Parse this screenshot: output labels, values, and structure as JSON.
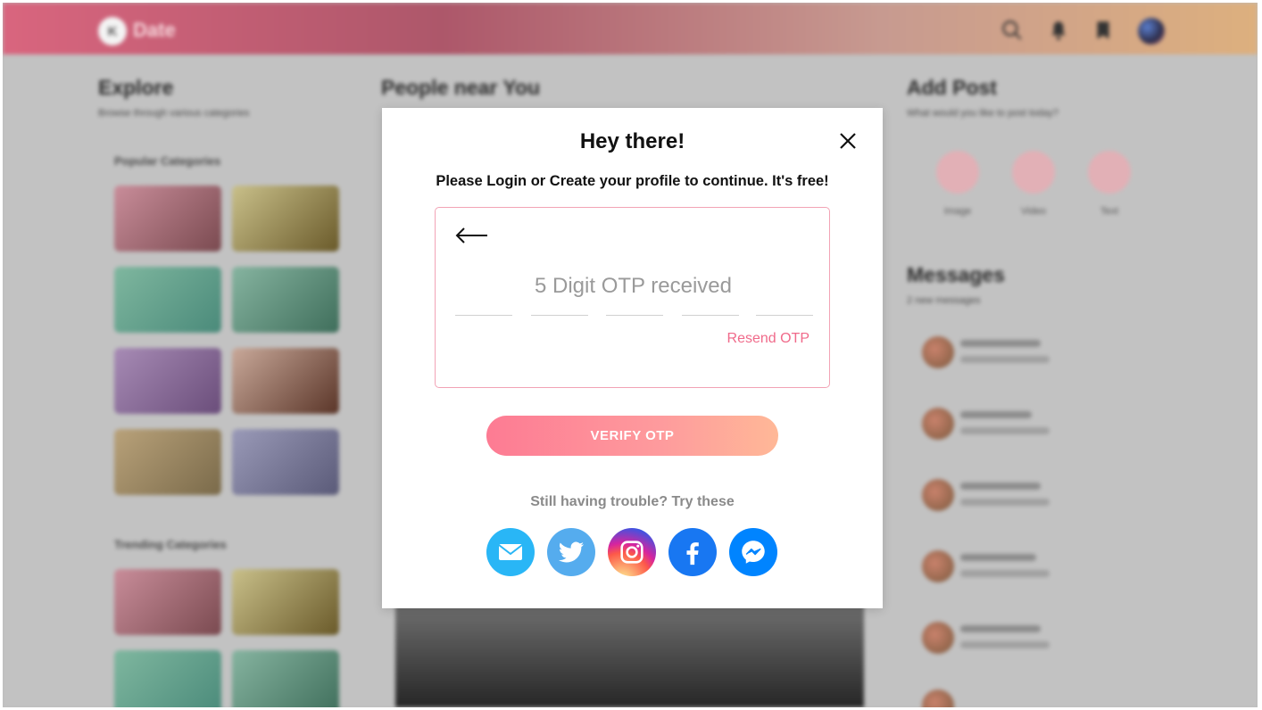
{
  "header": {
    "logo_letter": "K",
    "app_name": "Date",
    "icons": [
      "search-icon",
      "bell-icon",
      "bookmark-icon",
      "profile-avatar"
    ]
  },
  "background": {
    "explore_title": "Explore",
    "explore_subtitle": "Browse through various categories",
    "popular_label": "Popular Categories",
    "trending_label": "Trending Categories",
    "people_title": "People near You",
    "add_post_title": "Add Post",
    "add_post_subtitle": "What would you like to post today?",
    "post_types": [
      "Image",
      "Video",
      "Text"
    ],
    "messages_title": "Messages",
    "messages_subtitle": "2 new messages"
  },
  "modal": {
    "title": "Hey there!",
    "subtitle": "Please Login or Create your profile to continue. It's free!",
    "otp_hint": "5 Digit OTP received",
    "resend_label": "Resend OTP",
    "verify_label": "VERIFY OTP",
    "trouble_text": "Still having trouble? Try these",
    "social_icons": [
      "email-icon",
      "twitter-icon",
      "instagram-icon",
      "facebook-icon",
      "messenger-icon"
    ]
  },
  "colors": {
    "accent_pink": "#f06a8a",
    "verify_gradient_start": "#fd7b93",
    "verify_gradient_end": "#ffb897",
    "otp_border": "#f2a3b5",
    "email": "#29b6f6",
    "twitter": "#55acee",
    "facebook": "#1877f2",
    "messenger": "#0084ff"
  }
}
